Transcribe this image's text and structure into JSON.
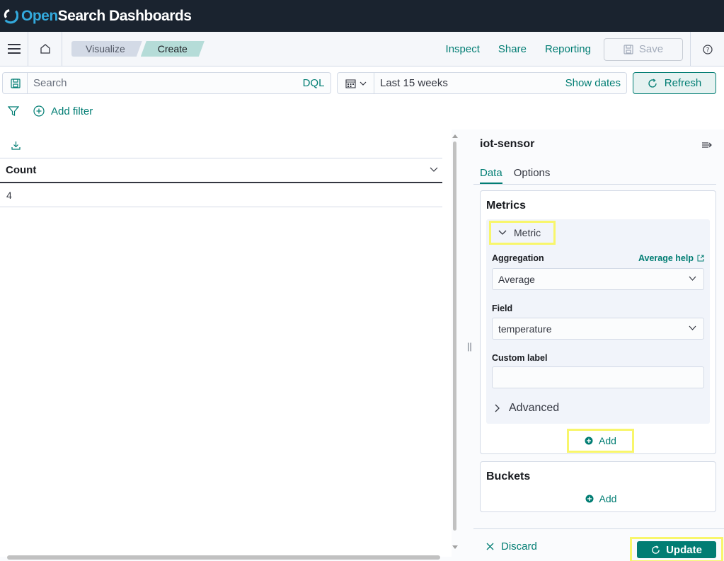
{
  "brand": {
    "prefix": "Open",
    "suffix": "Search Dashboards",
    "accent": "#33a9dc"
  },
  "nav": {
    "breadcrumbs": [
      "Visualize",
      "Create"
    ],
    "actions": {
      "inspect": "Inspect",
      "share": "Share",
      "reporting": "Reporting",
      "save": "Save"
    },
    "icons": [
      "menu-icon",
      "home-icon",
      "help-icon"
    ]
  },
  "query": {
    "search_placeholder": "Search",
    "language": "DQL",
    "time_range": "Last 15 weeks",
    "show_dates": "Show dates",
    "refresh": "Refresh"
  },
  "filters": {
    "add_filter": "Add filter"
  },
  "table": {
    "columns": [
      "Count"
    ],
    "rows": [
      [
        "4"
      ]
    ]
  },
  "editor": {
    "index_pattern": "iot-sensor",
    "tabs": [
      "Data",
      "Options"
    ],
    "metrics": {
      "title": "Metrics",
      "agg_title": "Metric",
      "aggregation_label": "Aggregation",
      "aggregation_help": "Average help",
      "aggregation_value": "Average",
      "field_label": "Field",
      "field_value": "temperature",
      "custom_label": "Custom label",
      "custom_label_value": "",
      "advanced": "Advanced",
      "add": "Add"
    },
    "buckets": {
      "title": "Buckets",
      "add": "Add"
    },
    "footer": {
      "discard": "Discard",
      "update": "Update"
    }
  },
  "colors": {
    "accent": "#017d73",
    "highlight": "#f8f66b",
    "header_bg": "#1a232f"
  }
}
